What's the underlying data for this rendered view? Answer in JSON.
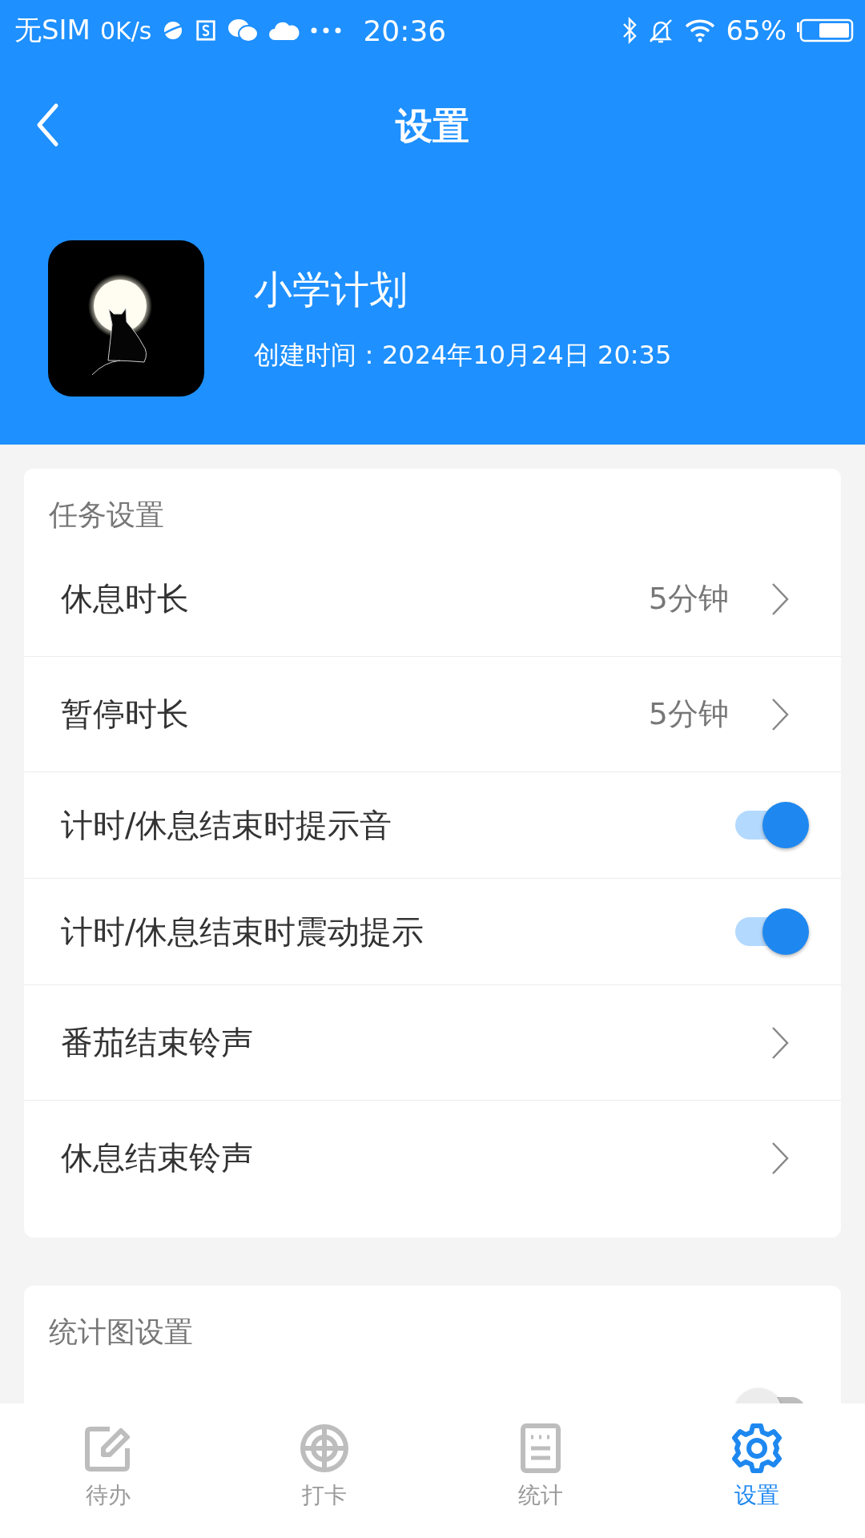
{
  "status_bar": {
    "carrier": "无SIM",
    "speed": "0K/s",
    "time": "20:36",
    "battery": "65%"
  },
  "header": {
    "title": "设置"
  },
  "profile": {
    "kind": "picture",
    "name": "小学计划",
    "created": "创建时间：2024年10月24日 20:35"
  },
  "sections": [
    {
      "title": "任务设置",
      "rows": [
        {
          "kind": "nav",
          "label": "休息时长",
          "value": "5分钟"
        },
        {
          "kind": "nav",
          "label": "暂停时长",
          "value": "5分钟"
        },
        {
          "kind": "toggle",
          "label": "计时/休息结束时提示音",
          "on": true
        },
        {
          "kind": "toggle",
          "label": "计时/休息结束时震动提示",
          "on": true
        },
        {
          "kind": "nav",
          "label": "番茄结束铃声"
        },
        {
          "kind": "nav",
          "label": "休息结束铃声"
        }
      ]
    },
    {
      "title": "统计图设置",
      "rows": [
        {
          "kind": "toggle",
          "on": false
        }
      ]
    }
  ],
  "tabs": [
    {
      "label": "待办",
      "selected": false
    },
    {
      "label": "打卡",
      "selected": false
    },
    {
      "label": "统计",
      "selected": false
    },
    {
      "label": "设置",
      "selected": true
    }
  ]
}
